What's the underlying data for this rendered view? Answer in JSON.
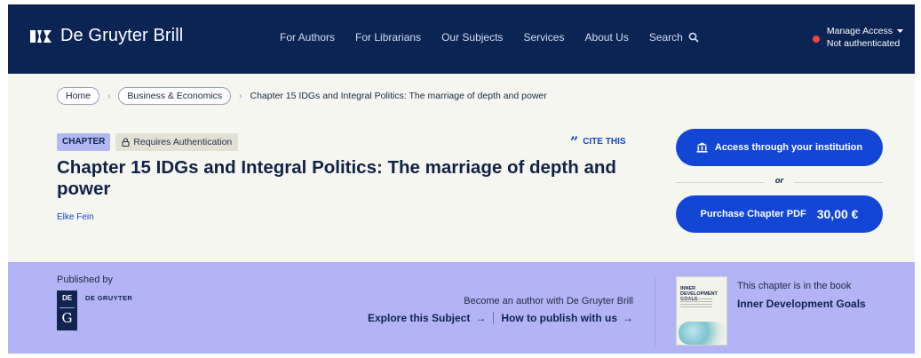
{
  "header": {
    "brand": "De Gruyter Brill",
    "nav": [
      "For Authors",
      "For Librarians",
      "Our Subjects",
      "Services",
      "About Us"
    ],
    "search_label": "Search",
    "manage_access": "Manage Access",
    "auth_status": "Not authenticated"
  },
  "breadcrumb": {
    "home": "Home",
    "category": "Business & Economics",
    "current": "Chapter 15 IDGs and Integral Politics: The marriage of depth and power"
  },
  "article": {
    "type_badge": "CHAPTER",
    "auth_badge": "Requires Authentication",
    "cite_label": "CITE THIS",
    "title": "Chapter 15 IDGs and Integral Politics: The marriage of depth and power",
    "author": "Elke Fein"
  },
  "actions": {
    "access_label": "Access through your institution",
    "or_label": "or",
    "purchase_label": "Purchase Chapter PDF",
    "price": "30,00 €"
  },
  "footer_band": {
    "published_by": "Published by",
    "publisher_logo_top": "DE",
    "publisher_logo_bottom": "G",
    "publisher_name": "DE GRUYTER",
    "become_author": "Become an author with De Gruyter Brill",
    "explore_link": "Explore this Subject",
    "publish_link": "How to publish with us",
    "book_note": "This chapter is in the book",
    "book_title": "Inner Development Goals",
    "cover_title": "INNER DEVELOPMENT GOALS"
  },
  "colors": {
    "header_bg": "#0b2454",
    "primary_button": "#1446d6",
    "band_bg": "#b2b4f6",
    "status_dot": "#f0463e"
  }
}
